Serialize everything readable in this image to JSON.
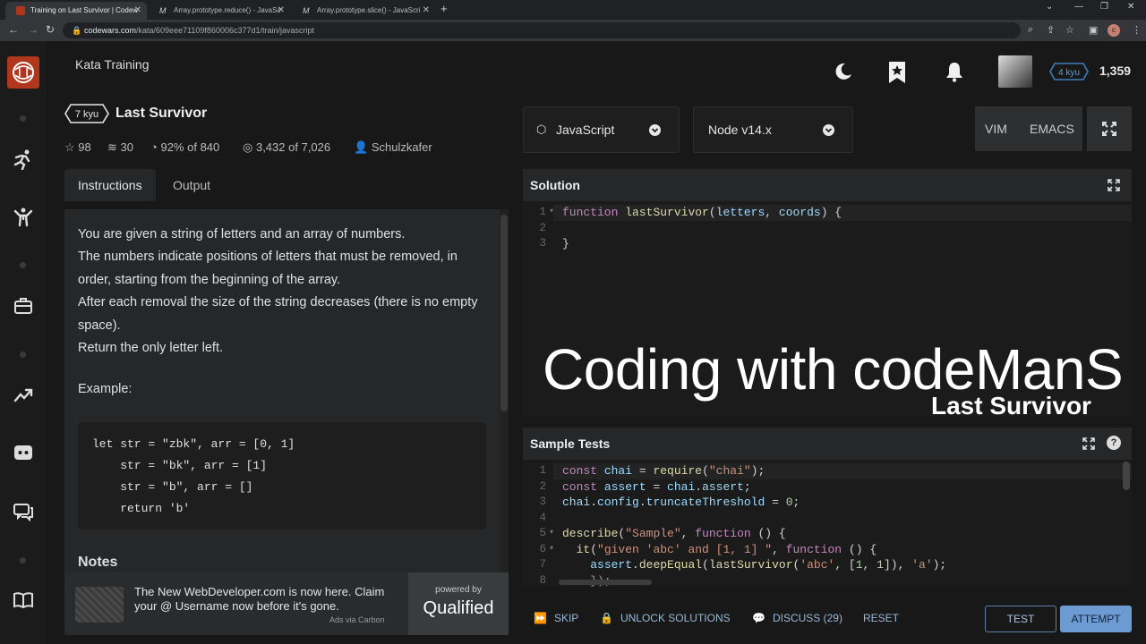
{
  "browser": {
    "tabs": [
      {
        "title": "Training on Last Survivor | Codew",
        "active": true
      },
      {
        "title": "Array.prototype.reduce() - JavaSc",
        "active": false
      },
      {
        "title": "Array.prototype.slice() - JavaScri",
        "active": false
      }
    ],
    "url_domain": "codewars.com",
    "url_path": "/kata/609eee71109f860006c377d1/train/javascript",
    "profile_initial": "c"
  },
  "header": {
    "title": "Kata Training",
    "rank": "4 kyu",
    "honor": "1,359"
  },
  "kata": {
    "kyu": "7 kyu",
    "title": "Last Survivor",
    "stars": "98",
    "collections": "30",
    "satisfaction_pct": "92%",
    "satisfaction_of": "of 840",
    "completed": "3,432",
    "completed_of": "of 7,026",
    "author": "Schulzkafer"
  },
  "left_tabs": {
    "instructions": "Instructions",
    "output": "Output"
  },
  "description": {
    "paragraphs": [
      "You are given a string of letters and an array of numbers.",
      "The numbers indicate positions of letters that must be removed, in order, starting from the beginning of the array.",
      "After each removal the size of the string decreases (there is no empty space).",
      "Return the only letter left."
    ],
    "example_label": "Example:",
    "example_code": [
      "let str = \"zbk\", arr = [0, 1]",
      "    str = \"bk\", arr = [1]",
      "    str = \"b\", arr = []",
      "    return 'b'"
    ],
    "notes_heading": "Notes"
  },
  "ad": {
    "text": "The New WebDeveloper.com is now here. Claim your @ Username now before it's gone.",
    "via": "Ads via Carbon",
    "powered_by": "powered by",
    "brand": "Qualified"
  },
  "editor_toolbar": {
    "language": "JavaScript",
    "runtime": "Node v14.x",
    "vim": "VIM",
    "emacs": "EMACS"
  },
  "solution": {
    "heading": "Solution",
    "line_numbers": [
      "1",
      "2",
      "3"
    ],
    "lines": [
      "function lastSurvivor(letters, coords) {",
      "",
      "}"
    ]
  },
  "overlay": {
    "title": "Coding with codeManS",
    "subtitle": "Last Survivor"
  },
  "sample_tests": {
    "heading": "Sample Tests",
    "line_numbers": [
      "1",
      "2",
      "3",
      "4",
      "5",
      "6",
      "7",
      "8"
    ],
    "lines": [
      "const chai = require(\"chai\");",
      "const assert = chai.assert;",
      "chai.config.truncateThreshold = 0;",
      "",
      "describe(\"Sample\", function () {",
      "  it(\"given 'abc' and [1, 1] \", function () {",
      "    assert.deepEqual(lastSurvivor('abc', [1, 1]), 'a');",
      "    });"
    ]
  },
  "actions": {
    "skip": "SKIP",
    "unlock": "UNLOCK SOLUTIONS",
    "discuss": "DISCUSS (29)",
    "reset": "RESET",
    "test": "TEST",
    "attempt": "ATTEMPT"
  },
  "colors": {
    "brand": "#b1361e",
    "attempt": "#6d9ad1",
    "rank_badge": "#3c7ebb"
  }
}
